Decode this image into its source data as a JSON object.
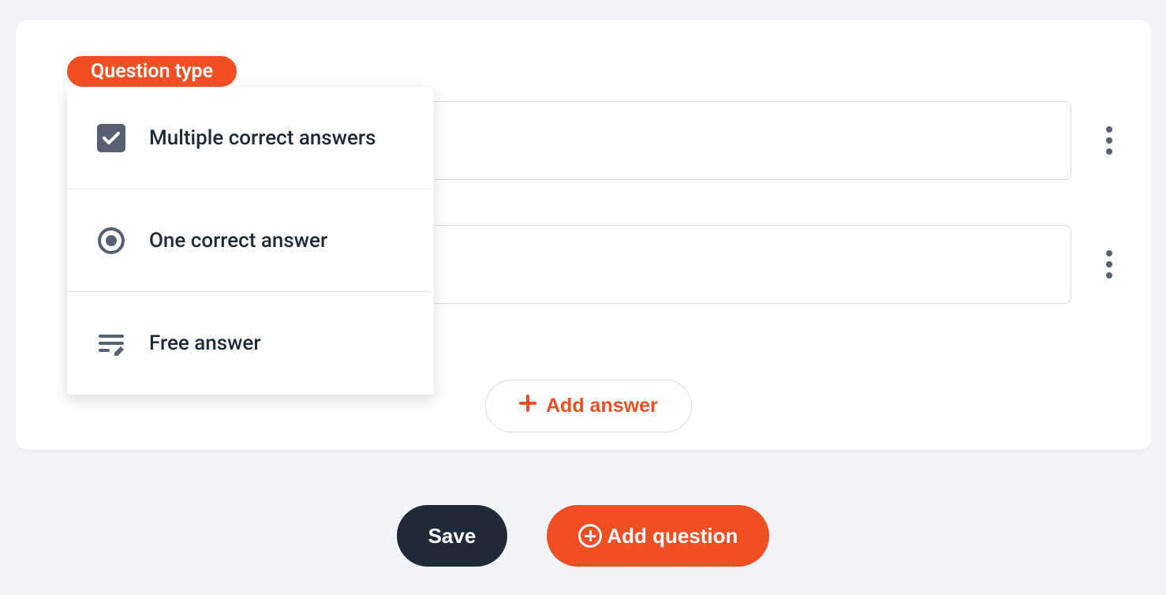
{
  "badge": {
    "label": "Question type"
  },
  "dropdown": {
    "items": [
      {
        "label": "Multiple correct answers"
      },
      {
        "label": "One correct answer"
      },
      {
        "label": "Free answer"
      }
    ]
  },
  "add_answer": {
    "label": "Add answer"
  },
  "footer": {
    "save_label": "Save",
    "add_question_label": "Add question"
  },
  "colors": {
    "accent": "#f04e23",
    "dark": "#1f2a37",
    "border": "#d7dde4",
    "page_bg": "#f2f4f7"
  }
}
